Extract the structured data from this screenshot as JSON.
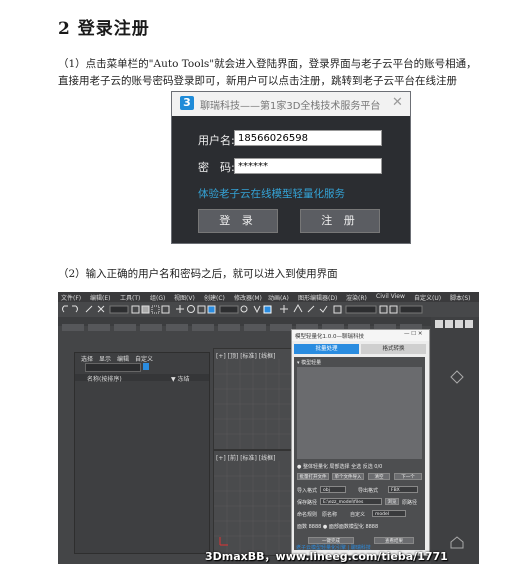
{
  "section": {
    "heading": "2 登录注册"
  },
  "paragraph1": {
    "line1": "（1）点击菜单栏的\"Auto Tools\"就会进入登陆界面，登录界面与老子云平台的账号相通，",
    "line2": "直接用老子云的账号密码登录即可，新用户可以点击注册，跳转到老子云平台在线注册"
  },
  "login_dialog": {
    "logo": "3",
    "title": "聊瑞科技——第1家3D全栈技术服务平台",
    "close": "✕",
    "username_label": "用户名:",
    "username_value": "18566026598",
    "password_label": "密　码:",
    "password_value": "******",
    "experience_link": "体验老子云在线模型轻量化服务",
    "login_button": "登 录",
    "register_button": "注 册"
  },
  "paragraph2": {
    "text": "（2）输入正确的用户名和密码之后，就可以进入到使用界面"
  },
  "max_screenshot": {
    "menu": [
      "文件(F)",
      "编辑(E)",
      "工具(T)",
      "组(G)",
      "视图(V)",
      "创建(C)",
      "修改器(M)",
      "动画(A)",
      "图形编辑器(D)",
      "渲染(R)",
      "Civil View",
      "自定义(U)",
      "脚本(S)"
    ],
    "explorer_tabs": [
      "选择",
      "显示",
      "编辑",
      "自定义"
    ],
    "explorer_header_name": "名称(按排序)",
    "explorer_header_sort": "▼ 冻结",
    "viewport_label_top": "[+] [顶] [标准] [线框]",
    "viewport_label_front": "[+] [前] [标准] [线框]",
    "plugin": {
      "title": "模型轻量化1.0.0—聊瑞科技",
      "tab_active": "批量处理",
      "tab_inactive": "格式转换",
      "section_title": "▾ 模型轻量",
      "option_row1": "● 整体轻量化  局部选择  全选  反选  0/0",
      "btn_batch_open": "批量打开文件",
      "btn_single_import": "单个文件导入",
      "btn_clear": "清空",
      "btn_next": "下一个",
      "import_format_label": "导入格式",
      "import_format_value": "obj",
      "export_format_label": "导出格式",
      "export_format_value": "FBX",
      "save_path_label": "保存路径",
      "save_path_value": "E:\\ezz_model\\files",
      "browse_btn": "浏览",
      "same_dir": "原路径",
      "name_label": "命名规则",
      "name_value": "原名称",
      "custom_label": "自定义",
      "custom_value": "model",
      "face_row": "面数   8888   ● 面部面数模型化   8888",
      "run_btn": "一键完成",
      "open_dir_btn": "查看结果",
      "status": "老子云模型轻量化引擎 | 聊瑞科技"
    }
  },
  "watermark": "3DmaxBB，www.lineeg.com/tieba/1771"
}
